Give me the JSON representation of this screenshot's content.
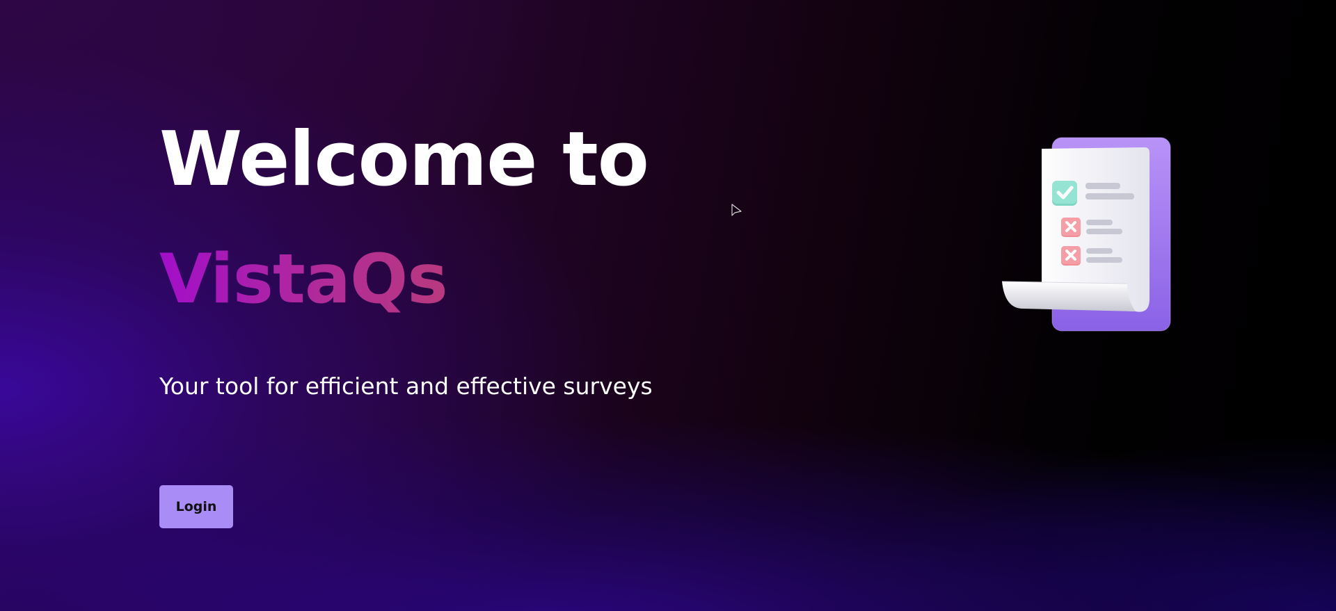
{
  "hero": {
    "title_line_1": "Welcome to",
    "title_line_2": "VistaQs",
    "subtitle": "Your tool for efficient and effective surveys"
  },
  "actions": {
    "login_label": "Login"
  },
  "illustration": {
    "icon": "survey-checklist-icon",
    "items": [
      {
        "status": "check",
        "icon": "check-icon"
      },
      {
        "status": "cross",
        "icon": "cross-icon"
      },
      {
        "status": "cross",
        "icon": "cross-icon"
      }
    ]
  },
  "colors": {
    "accent_button": "#a98cf6",
    "brand_gradient_start": "#a20fc9",
    "brand_gradient_end": "#b83a7e",
    "background_dark": "#000000",
    "background_purple": "#2a0640",
    "background_indigo": "#3c08aa"
  }
}
